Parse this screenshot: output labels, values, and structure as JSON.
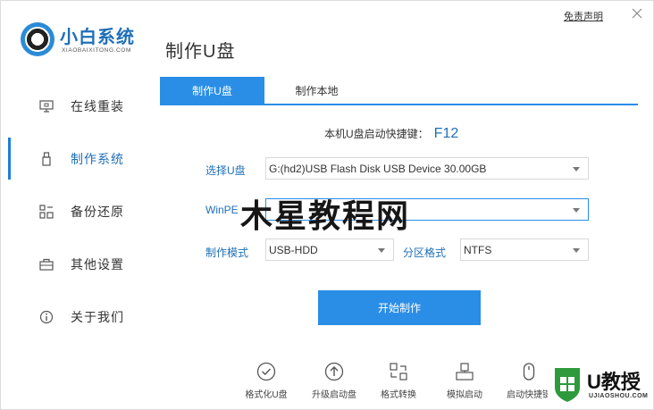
{
  "app": {
    "brand_title": "小白系统",
    "brand_subtitle": "XIAOBAIXITONG.COM",
    "page_title": "制作U盘",
    "disclaimer_link": "免责声明"
  },
  "sidebar": {
    "items": [
      {
        "label": "在线重装",
        "icon": "monitor-icon"
      },
      {
        "label": "制作系统",
        "icon": "usb-icon",
        "active": true
      },
      {
        "label": "备份还原",
        "icon": "grid-icon"
      },
      {
        "label": "其他设置",
        "icon": "toolbox-icon"
      },
      {
        "label": "关于我们",
        "icon": "info-icon"
      }
    ]
  },
  "tabs": [
    {
      "label": "制作U盘",
      "active": true
    },
    {
      "label": "制作本地",
      "active": false
    }
  ],
  "hotkey": {
    "label": "本机U盘启动快捷键：",
    "key": "F12"
  },
  "form": {
    "usb_label": "选择U盘",
    "usb_value": "G:(hd2)USB Flash Disk USB Device 30.00GB",
    "winpe_label": "WinPE",
    "winpe_value": "",
    "mode_label": "制作模式",
    "mode_value": "USB-HDD",
    "partition_label": "分区格式",
    "partition_value": "NTFS"
  },
  "start_button": "开始制作",
  "tools": [
    {
      "label": "格式化U盘",
      "icon": "check-circle-icon"
    },
    {
      "label": "升级启动盘",
      "icon": "upload-circle-icon"
    },
    {
      "label": "格式转换",
      "icon": "convert-icon"
    },
    {
      "label": "模拟启动",
      "icon": "usb-boot-icon"
    },
    {
      "label": "启动快捷键",
      "icon": "mouse-icon"
    }
  ],
  "watermarks": {
    "center": "木星教程网",
    "badge_title": "U教授",
    "badge_sub": "UJIAOSHOU.COM"
  },
  "colors": {
    "accent": "#2a8ee6",
    "brand": "#1e6fb8"
  }
}
